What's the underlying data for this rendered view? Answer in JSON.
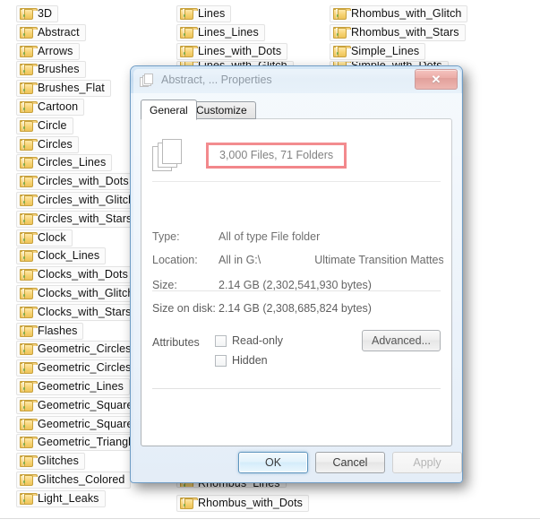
{
  "explorer": {
    "columns": [
      {
        "name": "column-1",
        "items": [
          "3D",
          "Abstract",
          "Arrows",
          "Brushes",
          "Brushes_Flat",
          "Cartoon",
          "Circle",
          "Circles",
          "Circles_Lines",
          "Circles_with_Dots",
          "Circles_with_Glitch",
          "Circles_with_Stars",
          "Clock",
          "Clock_Lines",
          "Clocks_with_Dots",
          "Clocks_with_Glitch",
          "Clocks_with_Stars",
          "Flashes",
          "Geometric_Circles",
          "Geometric_Circles_S",
          "Geometric_Lines",
          "Geometric_Squares",
          "Geometric_Squares_",
          "Geometric_Triangle",
          "Glitches",
          "Glitches_Colored",
          "Light_Leaks"
        ]
      },
      {
        "name": "column-2",
        "items": [
          "Lines",
          "Lines_Lines",
          "Lines_with_Dots",
          "Lines_with_Glitch",
          "Rhombus_Lines",
          "Rhombus_with_Dots"
        ]
      },
      {
        "name": "column-3",
        "items": [
          "Rhombus_with_Glitch",
          "Rhombus_with_Stars",
          "Simple_Lines",
          "Simple_with_Dots"
        ]
      }
    ]
  },
  "dialog": {
    "title": "Abstract, ... Properties",
    "title_icon": "multi-file-stack-icon",
    "close_label": "✕",
    "tabs": [
      {
        "label": "General",
        "active": true
      },
      {
        "label": "Customize",
        "active": false
      }
    ],
    "summary": {
      "icon": "multi-file-stack-icon",
      "count_text": "3,000 Files, 71 Folders",
      "highlight_color": "#e8232a"
    },
    "properties": [
      {
        "label": "Type:",
        "value": "All of type File folder"
      },
      {
        "label": "Location:",
        "value": "All in G:\\",
        "value_tail": "Ultimate Transition Mattes Pac"
      },
      {
        "label": "Size:",
        "value": "2.14 GB (2,302,541,930 bytes)"
      },
      {
        "label": "Size on disk:",
        "value": "2.14 GB (2,308,685,824 bytes)"
      }
    ],
    "attributes": {
      "label": "Attributes",
      "checkboxes": [
        {
          "label": "Read-only",
          "checked": false
        },
        {
          "label": "Hidden",
          "checked": false
        }
      ],
      "advanced_label": "Advanced..."
    },
    "buttons": [
      {
        "label": "OK",
        "state": "default"
      },
      {
        "label": "Cancel",
        "state": "normal"
      },
      {
        "label": "Apply",
        "state": "disabled"
      }
    ]
  }
}
